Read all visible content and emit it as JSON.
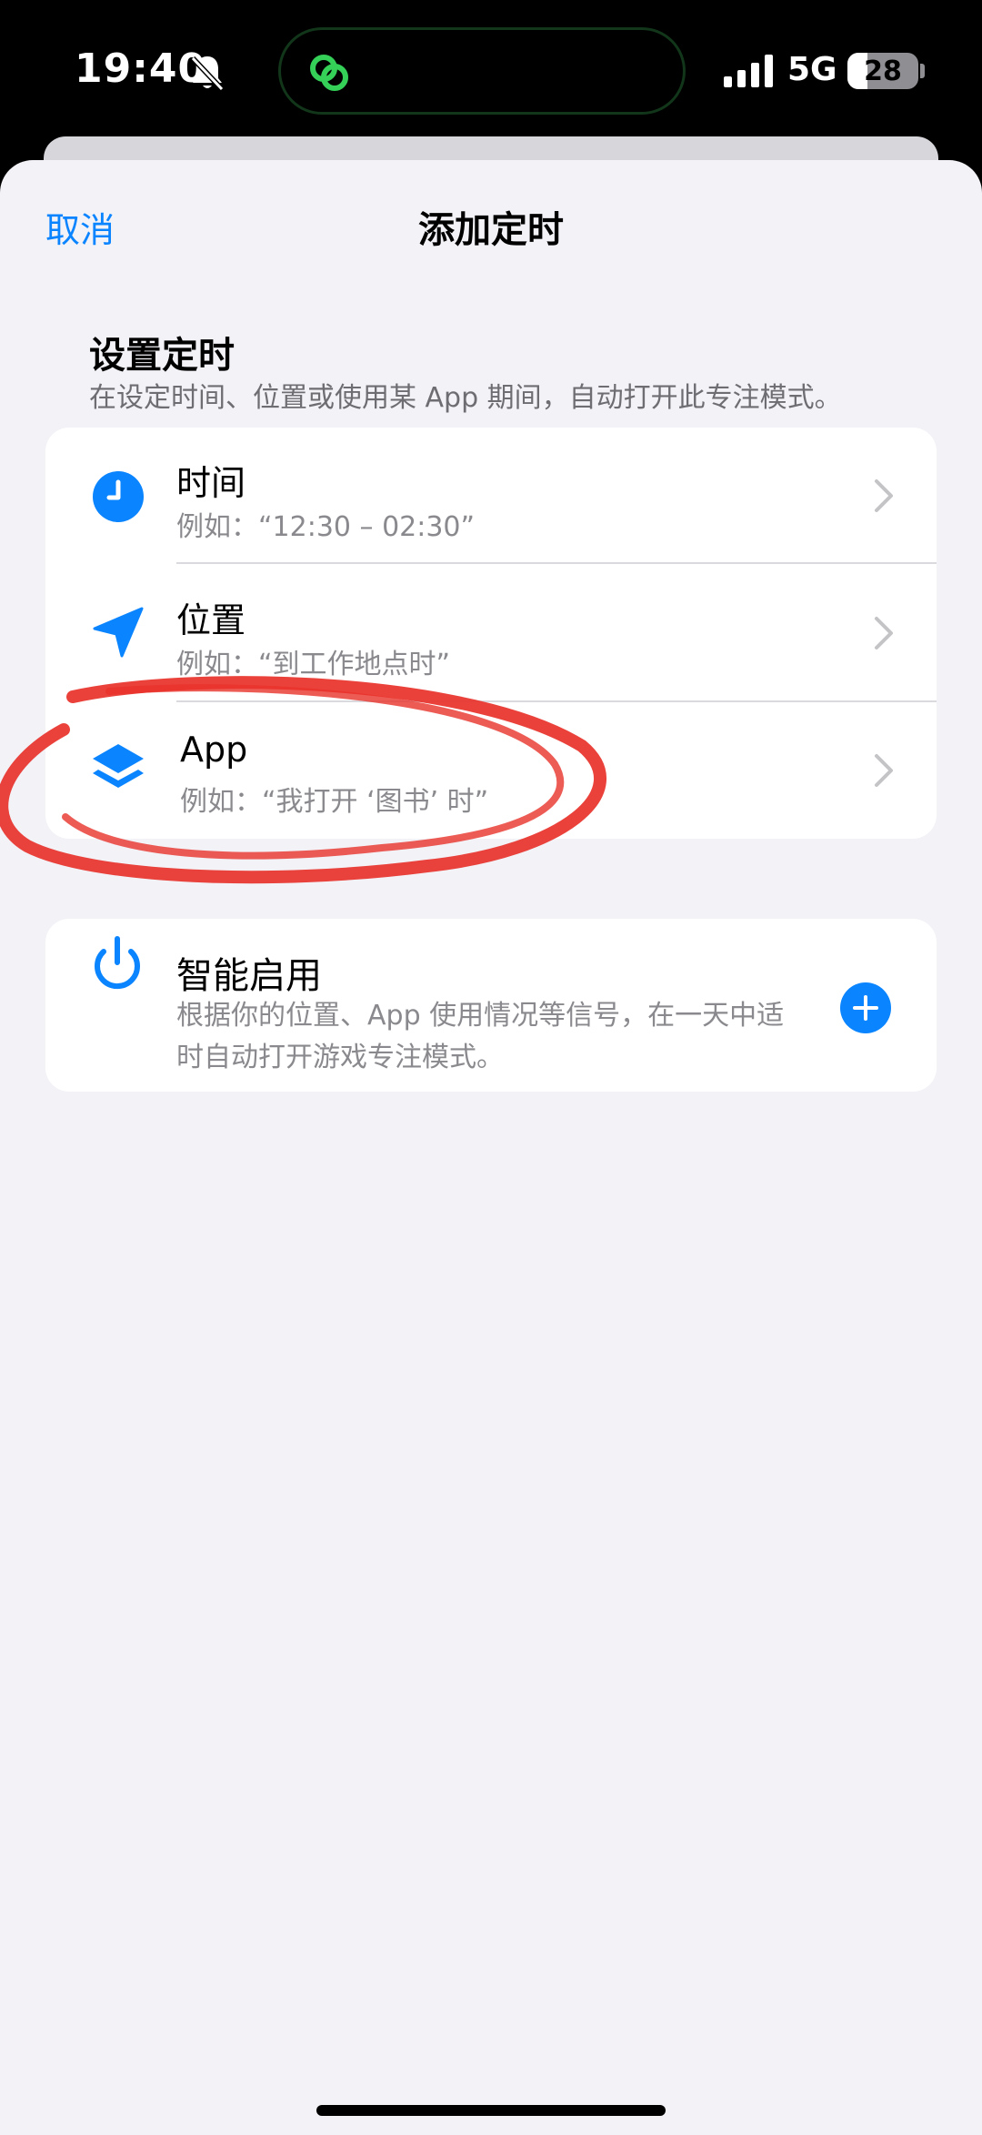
{
  "status_bar": {
    "time": "19:40",
    "network": "5G",
    "battery": "28",
    "battery_level": 0.28
  },
  "nav": {
    "cancel_label": "取消",
    "title": "添加定时"
  },
  "section": {
    "title": "设置定时",
    "description": "在设定时间、位置或使用某 App 期间，自动打开此专注模式。"
  },
  "schedule_options": [
    {
      "title": "时间",
      "subtitle": "例如：“12:30 – 02:30”",
      "icon": "clock-icon"
    },
    {
      "title": "位置",
      "subtitle": "例如：“到工作地点时”",
      "icon": "location-arrow-icon"
    },
    {
      "title": "App",
      "subtitle": "例如：“我打开 ‘图书’ 时”",
      "icon": "app-layers-icon"
    }
  ],
  "smart_activation": {
    "title": "智能启用",
    "description": "根据你的位置、App 使用情况等信号，在一天中适时自动打开游戏专注模式。",
    "icon": "power-icon",
    "toggle_icon": "plus-circle-icon"
  },
  "colors": {
    "accent": "#0a84ff",
    "background": "#f2f2f7",
    "annotation": "#e8322a"
  }
}
